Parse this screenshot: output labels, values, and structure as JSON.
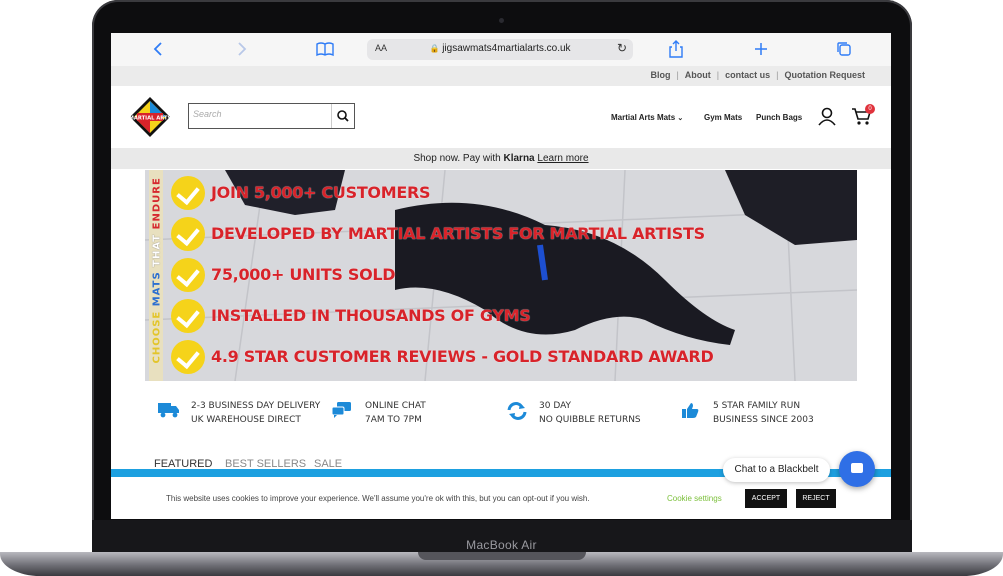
{
  "device": {
    "model": "MacBook Air"
  },
  "browser": {
    "url": "jigsawmats4martialarts.co.uk",
    "reader_label": "AA",
    "back_icon": "chevron-left-icon",
    "forward_icon": "chevron-right-icon",
    "book_icon": "book-icon",
    "share_icon": "share-icon",
    "new_tab_icon": "plus-icon",
    "tabs_icon": "tabs-icon",
    "reload_icon": "reload-icon"
  },
  "top_links": [
    "Blog",
    "About",
    "contact us",
    "Quotation Request"
  ],
  "header": {
    "logo_text": "MARTIAL ARTS",
    "search_placeholder": "Search",
    "nav": [
      "Martial Arts Mats",
      "Gym Mats",
      "Punch Bags"
    ],
    "cart_count": "0"
  },
  "klarna": {
    "prefix": "Shop now. Pay with",
    "brand": "Klarna",
    "link": "Learn more"
  },
  "banner": {
    "vertical_words": [
      "CHOOSE",
      "MATS",
      "THAT",
      "ENDURE"
    ],
    "bullets": [
      "JOIN 5,000+ CUSTOMERS",
      "DEVELOPED BY MARTIAL ARTISTS FOR MARTIAL ARTISTS",
      "75,000+ UNITS SOLD",
      "INSTALLED IN THOUSANDS OF GYMS",
      "4.9 STAR CUSTOMER REVIEWS - GOLD STANDARD AWARD"
    ]
  },
  "features": [
    {
      "icon": "truck-icon",
      "line1": "2-3 BUSINESS DAY DELIVERY",
      "line2": "UK WAREHOUSE DIRECT"
    },
    {
      "icon": "chat-icon",
      "line1": "ONLINE CHAT",
      "line2": "7AM TO 7PM"
    },
    {
      "icon": "refresh-icon",
      "line1": "30 DAY",
      "line2": "NO QUIBBLE RETURNS"
    },
    {
      "icon": "thumbs-up-icon",
      "line1": "5 STAR FAMILY RUN",
      "line2": "BUSINESS SINCE 2003"
    }
  ],
  "tabs": [
    "FEATURED",
    "BEST SELLERS",
    "SALE"
  ],
  "cookie": {
    "text": "This website uses cookies to improve your experience. We'll assume you're ok with this, but you can opt-out if you wish.",
    "settings": "Cookie settings",
    "accept": "ACCEPT",
    "reject": "REJECT"
  },
  "chat": {
    "label": "Chat to a Blackbelt"
  },
  "colors": {
    "accent_blue": "#1da0e0",
    "banner_red": "#d8232a",
    "check_yellow": "#f5d31a",
    "chat_blue": "#2f6fe6"
  }
}
